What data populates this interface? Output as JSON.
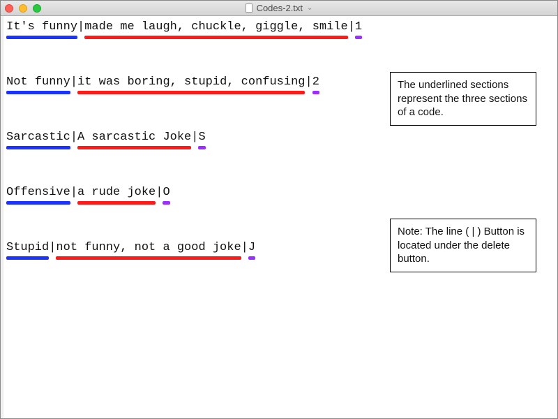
{
  "window": {
    "filename": "Codes-2.txt"
  },
  "entries": [
    {
      "label": "It's funny",
      "desc": "made me laugh, chuckle, giggle, smile",
      "code": "1"
    },
    {
      "label": "Not funny",
      "desc": "it was boring, stupid, confusing",
      "code": "2"
    },
    {
      "label": "Sarcastic",
      "desc": "A sarcastic Joke",
      "code": "S"
    },
    {
      "label": "Offensive",
      "desc": "a rude joke",
      "code": "O"
    },
    {
      "label": "Stupid",
      "desc": "not funny, not a good joke",
      "code": "J"
    }
  ],
  "callouts": {
    "c1": "The underlined sections represent the three sections of a code.",
    "c2": "Note: The line ( | ) Button is located under the delete button."
  },
  "sep": "|"
}
